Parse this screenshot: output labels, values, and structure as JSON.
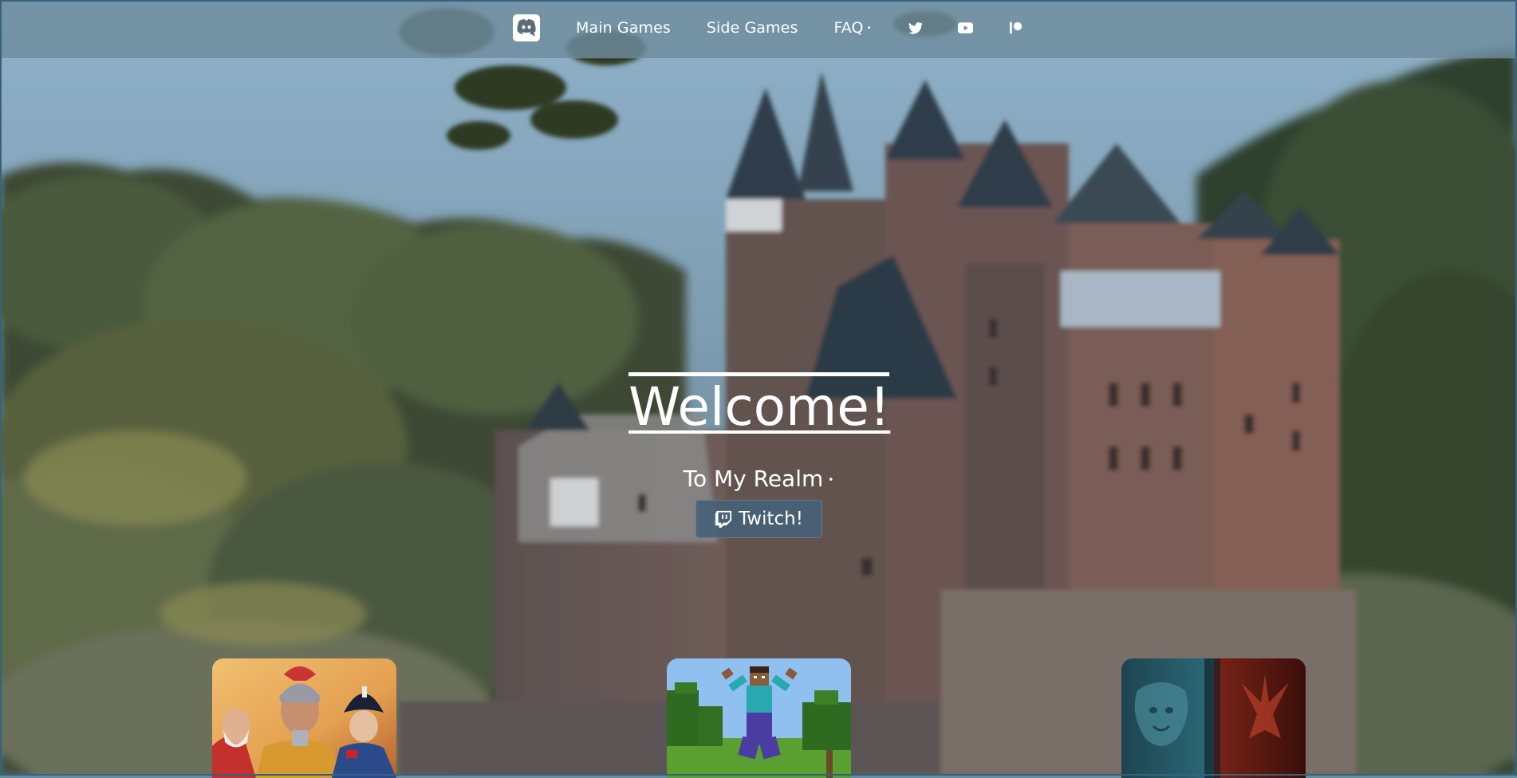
{
  "navbar": {
    "logo_icon": "discord-icon",
    "links": [
      {
        "label": "Main Games",
        "has_caret": false
      },
      {
        "label": "Side Games",
        "has_caret": false
      },
      {
        "label": "FAQ",
        "has_caret": true
      }
    ],
    "caret_glyph": "•",
    "social_icons": [
      "twitter-icon",
      "youtube-icon",
      "patreon-icon"
    ]
  },
  "hero": {
    "title": "Welcome!",
    "subtitle": "To My Realm",
    "subtitle_dot": "•",
    "button_label": "Twitch!",
    "button_icon": "twitch-icon"
  },
  "cards": [
    {
      "image": "historical-strategy-game-art"
    },
    {
      "image": "minecraft-game-art"
    },
    {
      "image": "warcraft-alliance-horde-art"
    }
  ],
  "colors": {
    "navbar_bg": "#6e8c9e",
    "button_bg": "#466078",
    "frame": "#35627e"
  }
}
